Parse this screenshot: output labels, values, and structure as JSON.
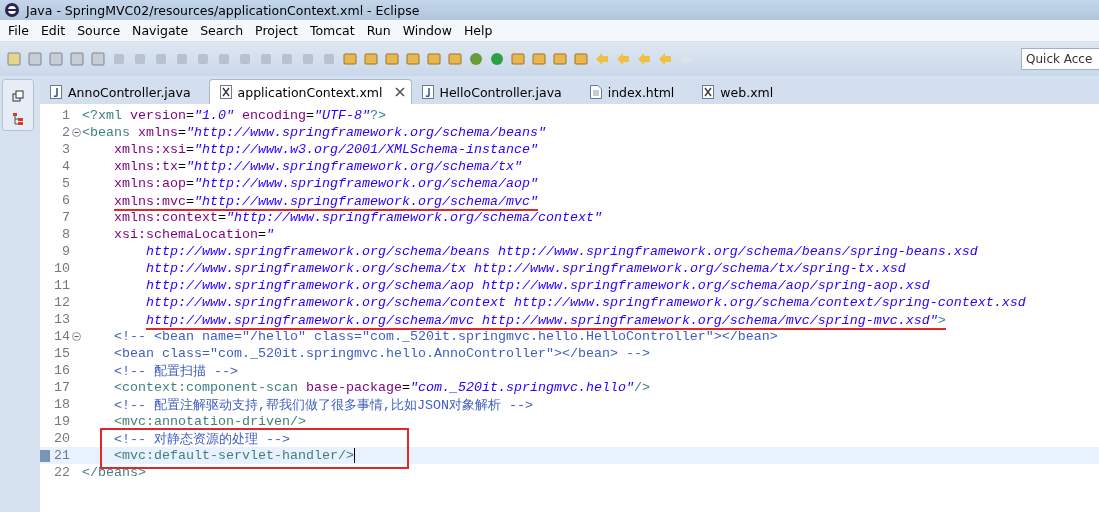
{
  "window": {
    "title": "Java - SpringMVC02/resources/applicationContext.xml - Eclipse"
  },
  "menu": [
    "File",
    "Edit",
    "Source",
    "Navigate",
    "Search",
    "Project",
    "Tomcat",
    "Run",
    "Window",
    "Help"
  ],
  "quick_access": {
    "placeholder": "Quick Acce"
  },
  "tabs": [
    {
      "label": "AnnoController.java",
      "kind": "java",
      "selected": false
    },
    {
      "label": "applicationContext.xml",
      "kind": "xml",
      "selected": true
    },
    {
      "label": "HelloController.java",
      "kind": "java",
      "selected": false
    },
    {
      "label": "index.html",
      "kind": "html",
      "selected": false
    },
    {
      "label": "web.xml",
      "kind": "xml",
      "selected": false
    }
  ],
  "editor": {
    "lines": [
      {
        "number": "1",
        "kind": "root",
        "segments": [
          {
            "kind": "tag",
            "text": "<?xml "
          },
          {
            "kind": "attr",
            "text": "version"
          },
          {
            "kind": "plain",
            "text": "="
          },
          {
            "kind": "value",
            "text": "\"1.0\" "
          },
          {
            "kind": "attr",
            "text": "encoding"
          },
          {
            "kind": "plain",
            "text": "="
          },
          {
            "kind": "value",
            "text": "\"UTF-8\""
          },
          {
            "kind": "tag",
            "text": "?>"
          }
        ],
        "foldable": false,
        "underlined": false,
        "boxed": false,
        "current": false
      },
      {
        "number": "2",
        "kind": "root",
        "segments": [
          {
            "kind": "tag",
            "text": "<beans "
          },
          {
            "kind": "attr",
            "text": "xmlns"
          },
          {
            "kind": "plain",
            "text": "="
          },
          {
            "kind": "value",
            "text": "\"http://www.springframework.org/schema/beans\""
          }
        ],
        "foldable": true,
        "underlined": false,
        "boxed": false,
        "current": false
      },
      {
        "number": "3",
        "kind": "inner",
        "segments": [
          {
            "kind": "attr",
            "text": "xmlns:xsi"
          },
          {
            "kind": "plain",
            "text": "="
          },
          {
            "kind": "value",
            "text": "\"http://www.w3.org/2001/XMLSchema-instance\""
          }
        ],
        "foldable": false,
        "underlined": false,
        "boxed": false,
        "current": false
      },
      {
        "number": "4",
        "kind": "inner",
        "segments": [
          {
            "kind": "attr",
            "text": "xmlns:tx"
          },
          {
            "kind": "plain",
            "text": "="
          },
          {
            "kind": "value",
            "text": "\"http://www.springframework.org/schema/tx\""
          }
        ],
        "foldable": false,
        "underlined": false,
        "boxed": false,
        "current": false
      },
      {
        "number": "5",
        "kind": "inner",
        "segments": [
          {
            "kind": "attr",
            "text": "xmlns:aop"
          },
          {
            "kind": "plain",
            "text": "="
          },
          {
            "kind": "value",
            "text": "\"http://www.springframework.org/schema/aop\""
          }
        ],
        "foldable": false,
        "underlined": false,
        "boxed": false,
        "current": false
      },
      {
        "number": "6",
        "kind": "inner",
        "segments": [
          {
            "kind": "attr",
            "text": "xmlns:mvc"
          },
          {
            "kind": "plain",
            "text": "="
          },
          {
            "kind": "value",
            "text": "\"http://www.springframework.org/schema/mvc\""
          }
        ],
        "foldable": false,
        "underlined": true,
        "boxed": false,
        "current": false
      },
      {
        "number": "7",
        "kind": "inner",
        "segments": [
          {
            "kind": "attr",
            "text": "xmlns:context"
          },
          {
            "kind": "plain",
            "text": "="
          },
          {
            "kind": "value",
            "text": "\"http://www.springframework.org/schema/context\""
          }
        ],
        "foldable": false,
        "underlined": false,
        "boxed": false,
        "current": false
      },
      {
        "number": "8",
        "kind": "inner",
        "segments": [
          {
            "kind": "attr",
            "text": "xsi:schemaLocation"
          },
          {
            "kind": "plain",
            "text": "="
          },
          {
            "kind": "value",
            "text": "\""
          }
        ],
        "foldable": false,
        "underlined": false,
        "boxed": false,
        "current": false
      },
      {
        "number": "9",
        "kind": "continuation",
        "segments": [
          {
            "kind": "value",
            "text": "http://www.springframework.org/schema/beans http://www.springframework.org/schema/beans/spring-beans.xsd"
          }
        ],
        "foldable": false,
        "underlined": false,
        "boxed": false,
        "current": false
      },
      {
        "number": "10",
        "kind": "continuation",
        "segments": [
          {
            "kind": "value",
            "text": "http://www.springframework.org/schema/tx http://www.springframework.org/schema/tx/spring-tx.xsd"
          }
        ],
        "foldable": false,
        "underlined": false,
        "boxed": false,
        "current": false
      },
      {
        "number": "11",
        "kind": "continuation",
        "segments": [
          {
            "kind": "value",
            "text": "http://www.springframework.org/schema/aop http://www.springframework.org/schema/aop/spring-aop.xsd"
          }
        ],
        "foldable": false,
        "underlined": false,
        "boxed": false,
        "current": false
      },
      {
        "number": "12",
        "kind": "continuation",
        "segments": [
          {
            "kind": "value",
            "text": "http://www.springframework.org/schema/context http://www.springframework.org/schema/context/spring-context.xsd"
          }
        ],
        "foldable": false,
        "underlined": false,
        "boxed": false,
        "current": false
      },
      {
        "number": "13",
        "kind": "continuation",
        "segments": [
          {
            "kind": "value",
            "text": "http://www.springframework.org/schema/mvc http://www.springframework.org/schema/mvc/spring-mvc.xsd\""
          },
          {
            "kind": "tag",
            "text": ">"
          }
        ],
        "foldable": false,
        "underlined": true,
        "boxed": false,
        "current": false
      },
      {
        "number": "14",
        "kind": "inner",
        "segments": [
          {
            "kind": "comment",
            "text": "<!-- <bean name=\"/hello\" class=\"com._520it.springmvc.hello.HelloController\"></bean>"
          }
        ],
        "foldable": true,
        "underlined": false,
        "boxed": false,
        "current": false
      },
      {
        "number": "15",
        "kind": "inner",
        "segments": [
          {
            "kind": "comment",
            "text": "<bean class=\"com._520it.springmvc.hello.AnnoController\"></bean> -->"
          }
        ],
        "foldable": false,
        "underlined": false,
        "boxed": false,
        "current": false
      },
      {
        "number": "16",
        "kind": "inner",
        "segments": [
          {
            "kind": "comment",
            "text": "<!-- 配置扫描 -->"
          }
        ],
        "foldable": false,
        "underlined": false,
        "boxed": false,
        "current": false
      },
      {
        "number": "17",
        "kind": "inner",
        "segments": [
          {
            "kind": "tag",
            "text": "<context:component-scan "
          },
          {
            "kind": "attr",
            "text": "base-package"
          },
          {
            "kind": "plain",
            "text": "="
          },
          {
            "kind": "value",
            "text": "\"com._520it.springmvc.hello\""
          },
          {
            "kind": "tag",
            "text": "/>"
          }
        ],
        "foldable": false,
        "underlined": false,
        "boxed": false,
        "current": false
      },
      {
        "number": "18",
        "kind": "inner",
        "segments": [
          {
            "kind": "comment",
            "text": "<!-- 配置注解驱动支持,帮我们做了很多事情,比如JSON对象解析 -->"
          }
        ],
        "foldable": false,
        "underlined": false,
        "boxed": false,
        "current": false
      },
      {
        "number": "19",
        "kind": "inner",
        "segments": [
          {
            "kind": "tag",
            "text": "<mvc:annotation-driven/>"
          }
        ],
        "foldable": false,
        "underlined": false,
        "boxed": false,
        "current": false
      },
      {
        "number": "20",
        "kind": "inner",
        "segments": [
          {
            "kind": "comment",
            "text": "<!-- 对静态资源的处理 -->"
          }
        ],
        "foldable": false,
        "underlined": false,
        "boxed": true,
        "current": false
      },
      {
        "number": "21",
        "kind": "inner",
        "segments": [
          {
            "kind": "tag",
            "text": "<mvc:default-servlet-handler/>"
          }
        ],
        "foldable": false,
        "underlined": false,
        "boxed": true,
        "current": true
      },
      {
        "number": "22",
        "kind": "root",
        "segments": [
          {
            "kind": "tag",
            "text": "</beans>"
          }
        ],
        "foldable": false,
        "underlined": false,
        "boxed": false,
        "current": false
      }
    ]
  }
}
